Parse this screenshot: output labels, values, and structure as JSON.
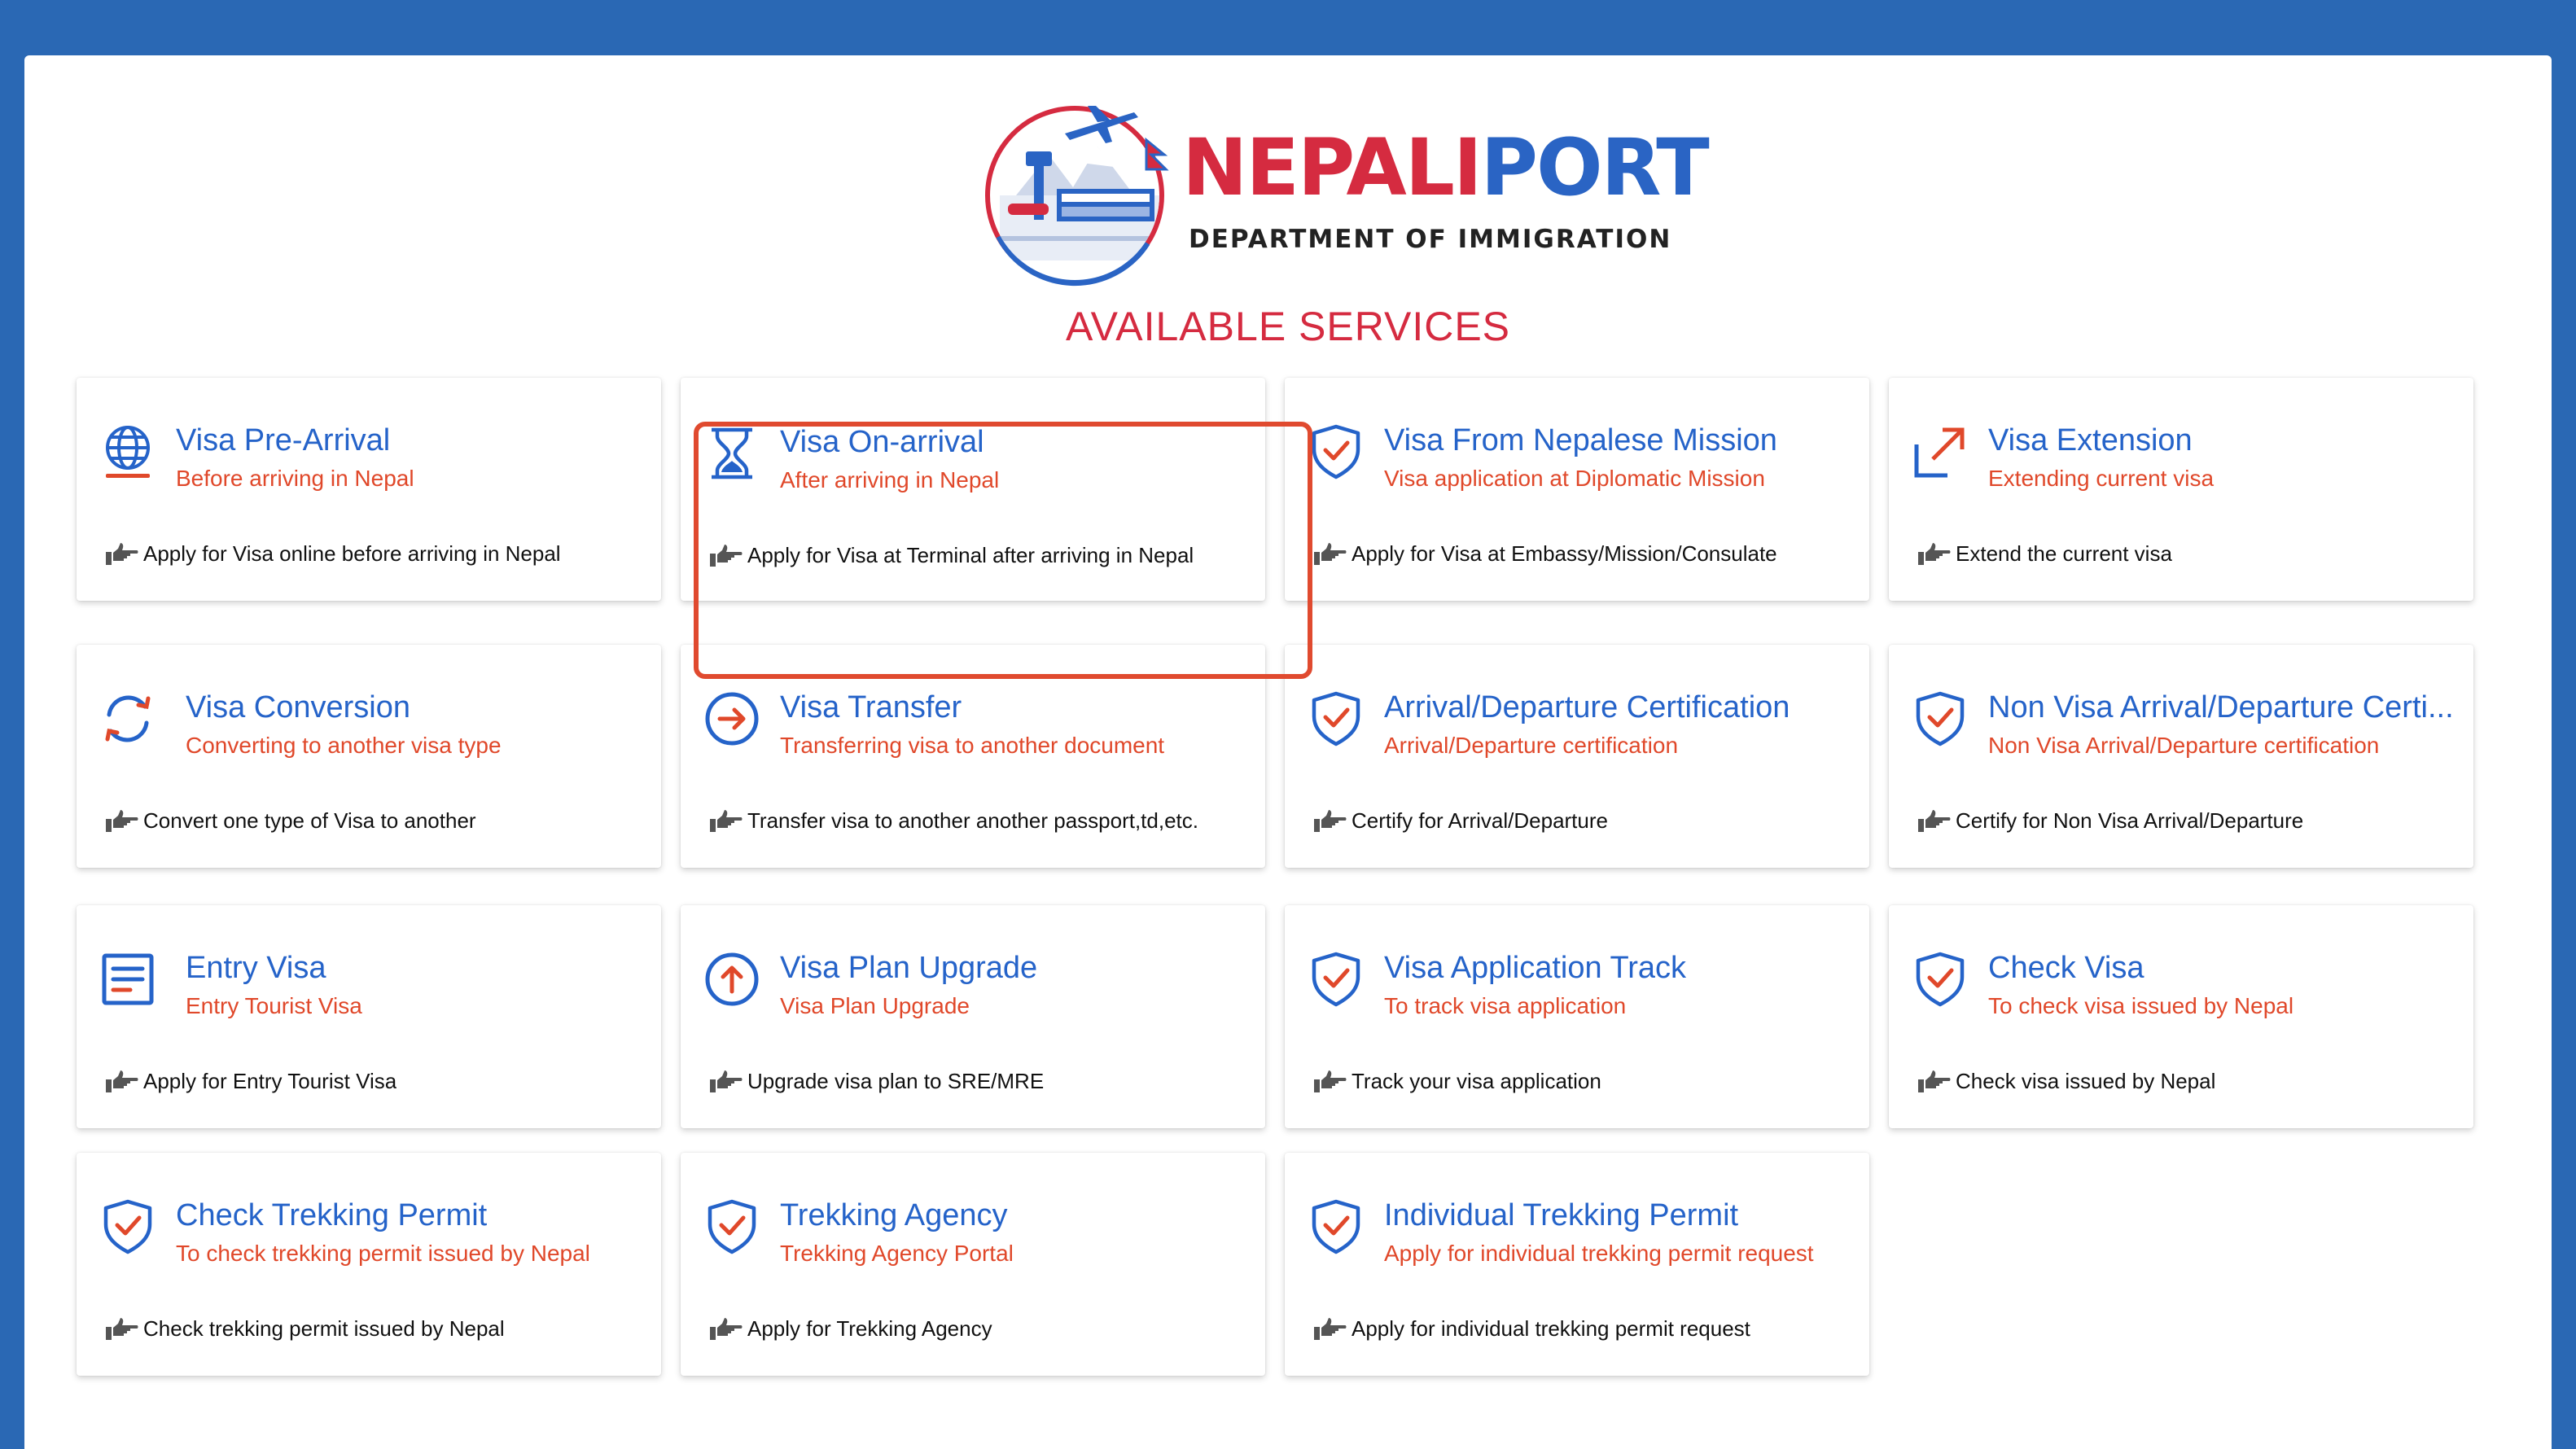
{
  "header": {
    "logo_title_part1": "NEPALI",
    "logo_title_part2": "PORT",
    "logo_subtitle": "DEPARTMENT OF IMMIGRATION",
    "section_title": "AVAILABLE SERVICES"
  },
  "colors": {
    "background": "#2a68b4",
    "brand_red": "#d52b40",
    "brand_blue": "#2563c9",
    "subtitle_orange": "#e0482a",
    "highlight_border": "#e04a2f"
  },
  "services": [
    {
      "title": "Visa Pre-Arrival",
      "subtitle": "Before arriving in Nepal",
      "description": "Apply for Visa online before arriving in Nepal",
      "icon": "globe-icon"
    },
    {
      "title": "Visa On-arrival",
      "subtitle": "After arriving in Nepal",
      "description": "Apply for Visa at Terminal after arriving in Nepal",
      "icon": "hourglass-icon",
      "highlighted": true
    },
    {
      "title": "Visa From Nepalese Mission",
      "subtitle": "Visa application at Diplomatic Mission",
      "description": "Apply for Visa at Embassy/Mission/Consulate",
      "icon": "shield-check-icon"
    },
    {
      "title": "Visa Extension",
      "subtitle": "Extending current visa",
      "description": "Extend the current visa",
      "icon": "arrow-up-right-icon"
    },
    {
      "title": "Visa Conversion",
      "subtitle": "Converting to another visa type",
      "description": "Convert one type of Visa to another",
      "icon": "refresh-icon"
    },
    {
      "title": "Visa Transfer",
      "subtitle": "Transferring visa to another document",
      "description": "Transfer visa to another another passport,td,etc.",
      "icon": "arrow-circle-right-icon"
    },
    {
      "title": "Arrival/Departure Certification",
      "subtitle": "Arrival/Departure certification",
      "description": "Certify for Arrival/Departure",
      "icon": "shield-check-icon"
    },
    {
      "title": "Non Visa Arrival/Departure Certi...",
      "subtitle": "Non Visa Arrival/Departure certification",
      "description": "Certify for Non Visa Arrival/Departure",
      "icon": "shield-check-icon"
    },
    {
      "title": "Entry Visa",
      "subtitle": "Entry Tourist Visa",
      "description": "Apply for Entry Tourist Visa",
      "icon": "document-list-icon"
    },
    {
      "title": "Visa Plan Upgrade",
      "subtitle": "Visa Plan Upgrade",
      "description": "Upgrade visa plan to SRE/MRE",
      "icon": "arrow-circle-up-icon"
    },
    {
      "title": "Visa Application Track",
      "subtitle": "To track visa application",
      "description": "Track your visa application",
      "icon": "shield-check-icon"
    },
    {
      "title": "Check Visa",
      "subtitle": "To check visa issued by Nepal",
      "description": "Check visa issued by Nepal",
      "icon": "shield-check-icon"
    },
    {
      "title": "Check Trekking Permit",
      "subtitle": "To check trekking permit issued by Nepal",
      "description": "Check trekking permit issued by Nepal",
      "icon": "shield-check-icon"
    },
    {
      "title": "Trekking Agency",
      "subtitle": "Trekking Agency Portal",
      "description": "Apply for Trekking Agency",
      "icon": "shield-check-icon"
    },
    {
      "title": "Individual Trekking Permit",
      "subtitle": "Apply for individual trekking permit request",
      "description": "Apply for individual trekking permit request",
      "icon": "shield-check-icon"
    }
  ]
}
